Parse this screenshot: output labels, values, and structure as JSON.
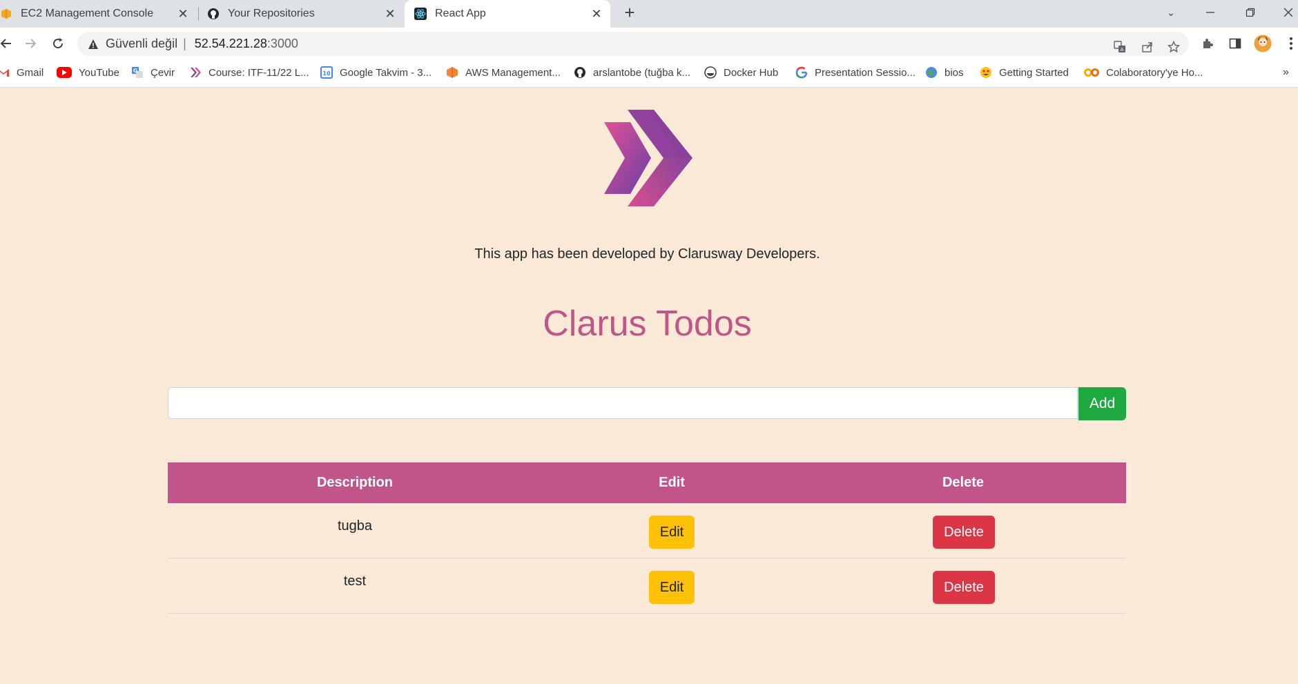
{
  "browser": {
    "tabs": [
      {
        "title": "EC2 Management Console",
        "icon": "aws-icon"
      },
      {
        "title": "Your Repositories",
        "icon": "github-icon"
      },
      {
        "title": "React App",
        "icon": "react-icon",
        "active": true
      }
    ],
    "address": {
      "security_label": "Güvenli değil",
      "host": "52.54.221.28",
      "port": ":3000"
    },
    "bookmarks": [
      {
        "label": "Gmail",
        "icon": "gmail-icon"
      },
      {
        "label": "YouTube",
        "icon": "youtube-icon"
      },
      {
        "label": "Çevir",
        "icon": "translate-icon"
      },
      {
        "label": "Course: ITF-11/22 L...",
        "icon": "clarusway-icon"
      },
      {
        "label": "Google Takvim - 3...",
        "icon": "calendar-icon"
      },
      {
        "label": "AWS Management...",
        "icon": "aws-icon"
      },
      {
        "label": "arslantobe (tuğba k...",
        "icon": "github-icon"
      },
      {
        "label": "Docker Hub",
        "icon": "docker-icon"
      },
      {
        "label": "Presentation Sessio...",
        "icon": "google-icon"
      },
      {
        "label": "bios",
        "icon": "globe-icon"
      },
      {
        "label": "Getting Started",
        "icon": "emoji-icon"
      },
      {
        "label": "Colaboratory'ye Ho...",
        "icon": "colab-icon"
      }
    ]
  },
  "app": {
    "credit": "This app has been developed by Clarusway Developers.",
    "title": "Clarus Todos",
    "input": {
      "value": "",
      "placeholder": ""
    },
    "add_label": "Add",
    "table": {
      "headers": {
        "description": "Description",
        "edit": "Edit",
        "delete": "Delete"
      },
      "rows": [
        {
          "description": "tugba",
          "edit_label": "Edit",
          "delete_label": "Delete"
        },
        {
          "description": "test",
          "edit_label": "Edit",
          "delete_label": "Delete"
        }
      ]
    }
  },
  "colors": {
    "page_bg": "#f9e9d6",
    "accent": "#c1558a",
    "add_button": "#1fa740",
    "edit_button": "#ffc107",
    "delete_button": "#dc3545"
  }
}
